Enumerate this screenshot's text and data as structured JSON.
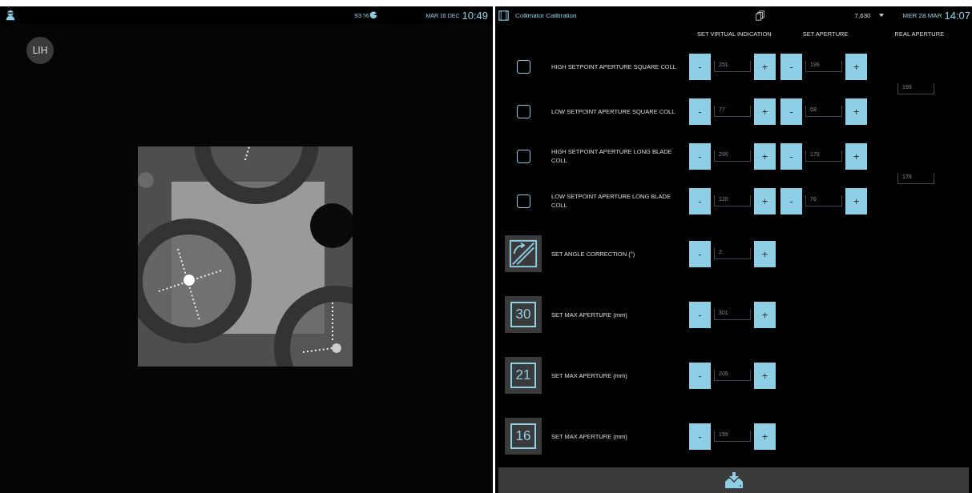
{
  "left_panel": {
    "status": {
      "battery": "93 %",
      "date": "MAR 16 DEC",
      "time": "10:49"
    },
    "badge": "LIH"
  },
  "window": {
    "title": "Collimator Calibration",
    "counter": "7,630",
    "date": "MER 28 MAR",
    "time": "14:07"
  },
  "columns": [
    "SET VIRTUAL INDICATION",
    "SET APERTURE",
    "REAL APERTURE"
  ],
  "setpoint_groups": [
    {
      "real_aperture": "199",
      "rows": [
        {
          "label": "HIGH SETPOINT APERTURE SQUARE COLL",
          "checked": false,
          "virtual_indication": "251",
          "aperture": "199"
        },
        {
          "label": "LOW SETPOINT APERTURE SQUARE COLL",
          "checked": false,
          "virtual_indication": "77",
          "aperture": "68"
        }
      ]
    },
    {
      "real_aperture": "179",
      "rows": [
        {
          "label": "HIGH SETPOINT APERTURE LONG BLADE COLL",
          "checked": false,
          "virtual_indication": "290",
          "aperture": "179"
        },
        {
          "label": "LOW SETPOINT APERTURE LONG BLADE COLL",
          "checked": false,
          "virtual_indication": "120",
          "aperture": "76"
        }
      ]
    }
  ],
  "settings": [
    {
      "kind": "angle",
      "label": "SET ANGLE CORRECTION (°)",
      "value": "2"
    },
    {
      "kind": "number",
      "tile": "30",
      "label": "SET MAX APERTURE (mm)",
      "value": "301"
    },
    {
      "kind": "number",
      "tile": "21",
      "label": "SET MAX APERTURE (mm)",
      "value": "209"
    },
    {
      "kind": "number",
      "tile": "16",
      "label": "SET MAX APERTURE (mm)",
      "value": "159"
    }
  ],
  "minus": "-",
  "plus": "+"
}
